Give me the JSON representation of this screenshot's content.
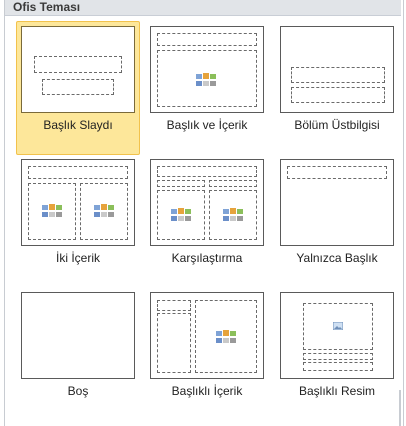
{
  "gallery": {
    "title": "Ofis Teması",
    "layouts": [
      {
        "label": "Başlık Slaydı",
        "selected": true
      },
      {
        "label": "Başlık ve İçerik",
        "selected": false
      },
      {
        "label": "Bölüm Üstbilgisi",
        "selected": false
      },
      {
        "label": "İki İçerik",
        "selected": false
      },
      {
        "label": "Karşılaştırma",
        "selected": false
      },
      {
        "label": "Yalnızca Başlık",
        "selected": false
      },
      {
        "label": "Boş",
        "selected": false
      },
      {
        "label": "Başlıklı İçerik",
        "selected": false
      },
      {
        "label": "Başlıklı Resim",
        "selected": false
      }
    ]
  },
  "colors": {
    "selected_fill": "#fde79a",
    "selected_border": "#f2c24c"
  }
}
